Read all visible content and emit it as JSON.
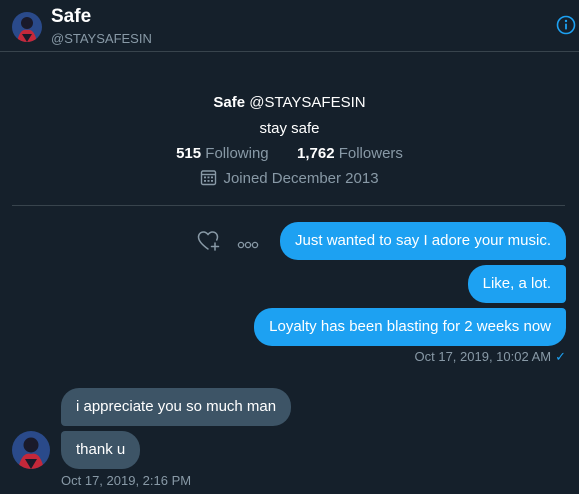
{
  "header": {
    "name": "Safe",
    "handle": "@STAYSAFESIN",
    "info_icon": "info-circle-icon"
  },
  "profile": {
    "name": "Safe",
    "handle": "@STAYSAFESIN",
    "bio": "stay safe",
    "following_count": "515",
    "following_label": "Following",
    "followers_count": "1,762",
    "followers_label": "Followers",
    "joined": "Joined December 2013",
    "joined_icon": "calendar-icon"
  },
  "messages": {
    "sent": [
      {
        "text": "Just wanted to say I adore your music."
      },
      {
        "text": "Like, a lot."
      },
      {
        "text": "Loyalty has been blasting for 2 weeks now"
      }
    ],
    "sent_timestamp": "Oct 17, 2019, 10:02 AM",
    "sent_status": "✓",
    "received": [
      {
        "text": "i appreciate you so much man"
      },
      {
        "text": "thank u"
      }
    ],
    "received_timestamp": "Oct 17, 2019, 2:16 PM"
  },
  "icons": {
    "react": "heart-plus-icon",
    "more": "more-dots-icon"
  },
  "colors": {
    "background": "#15202b",
    "sent_bubble": "#1da1f2",
    "received_bubble": "#3d5466",
    "muted_text": "#8899a6",
    "accent": "#1da1f2"
  }
}
